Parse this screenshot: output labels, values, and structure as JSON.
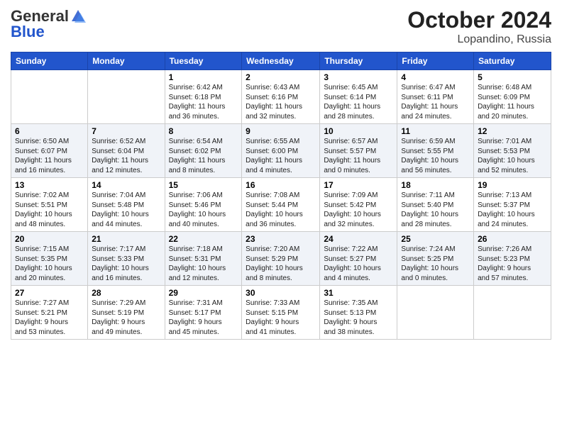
{
  "header": {
    "logo_general": "General",
    "logo_blue": "Blue",
    "title": "October 2024",
    "location": "Lopandino, Russia"
  },
  "weekdays": [
    "Sunday",
    "Monday",
    "Tuesday",
    "Wednesday",
    "Thursday",
    "Friday",
    "Saturday"
  ],
  "weeks": [
    [
      {
        "day": "",
        "info": ""
      },
      {
        "day": "",
        "info": ""
      },
      {
        "day": "1",
        "info": "Sunrise: 6:42 AM\nSunset: 6:18 PM\nDaylight: 11 hours\nand 36 minutes."
      },
      {
        "day": "2",
        "info": "Sunrise: 6:43 AM\nSunset: 6:16 PM\nDaylight: 11 hours\nand 32 minutes."
      },
      {
        "day": "3",
        "info": "Sunrise: 6:45 AM\nSunset: 6:14 PM\nDaylight: 11 hours\nand 28 minutes."
      },
      {
        "day": "4",
        "info": "Sunrise: 6:47 AM\nSunset: 6:11 PM\nDaylight: 11 hours\nand 24 minutes."
      },
      {
        "day": "5",
        "info": "Sunrise: 6:48 AM\nSunset: 6:09 PM\nDaylight: 11 hours\nand 20 minutes."
      }
    ],
    [
      {
        "day": "6",
        "info": "Sunrise: 6:50 AM\nSunset: 6:07 PM\nDaylight: 11 hours\nand 16 minutes."
      },
      {
        "day": "7",
        "info": "Sunrise: 6:52 AM\nSunset: 6:04 PM\nDaylight: 11 hours\nand 12 minutes."
      },
      {
        "day": "8",
        "info": "Sunrise: 6:54 AM\nSunset: 6:02 PM\nDaylight: 11 hours\nand 8 minutes."
      },
      {
        "day": "9",
        "info": "Sunrise: 6:55 AM\nSunset: 6:00 PM\nDaylight: 11 hours\nand 4 minutes."
      },
      {
        "day": "10",
        "info": "Sunrise: 6:57 AM\nSunset: 5:57 PM\nDaylight: 11 hours\nand 0 minutes."
      },
      {
        "day": "11",
        "info": "Sunrise: 6:59 AM\nSunset: 5:55 PM\nDaylight: 10 hours\nand 56 minutes."
      },
      {
        "day": "12",
        "info": "Sunrise: 7:01 AM\nSunset: 5:53 PM\nDaylight: 10 hours\nand 52 minutes."
      }
    ],
    [
      {
        "day": "13",
        "info": "Sunrise: 7:02 AM\nSunset: 5:51 PM\nDaylight: 10 hours\nand 48 minutes."
      },
      {
        "day": "14",
        "info": "Sunrise: 7:04 AM\nSunset: 5:48 PM\nDaylight: 10 hours\nand 44 minutes."
      },
      {
        "day": "15",
        "info": "Sunrise: 7:06 AM\nSunset: 5:46 PM\nDaylight: 10 hours\nand 40 minutes."
      },
      {
        "day": "16",
        "info": "Sunrise: 7:08 AM\nSunset: 5:44 PM\nDaylight: 10 hours\nand 36 minutes."
      },
      {
        "day": "17",
        "info": "Sunrise: 7:09 AM\nSunset: 5:42 PM\nDaylight: 10 hours\nand 32 minutes."
      },
      {
        "day": "18",
        "info": "Sunrise: 7:11 AM\nSunset: 5:40 PM\nDaylight: 10 hours\nand 28 minutes."
      },
      {
        "day": "19",
        "info": "Sunrise: 7:13 AM\nSunset: 5:37 PM\nDaylight: 10 hours\nand 24 minutes."
      }
    ],
    [
      {
        "day": "20",
        "info": "Sunrise: 7:15 AM\nSunset: 5:35 PM\nDaylight: 10 hours\nand 20 minutes."
      },
      {
        "day": "21",
        "info": "Sunrise: 7:17 AM\nSunset: 5:33 PM\nDaylight: 10 hours\nand 16 minutes."
      },
      {
        "day": "22",
        "info": "Sunrise: 7:18 AM\nSunset: 5:31 PM\nDaylight: 10 hours\nand 12 minutes."
      },
      {
        "day": "23",
        "info": "Sunrise: 7:20 AM\nSunset: 5:29 PM\nDaylight: 10 hours\nand 8 minutes."
      },
      {
        "day": "24",
        "info": "Sunrise: 7:22 AM\nSunset: 5:27 PM\nDaylight: 10 hours\nand 4 minutes."
      },
      {
        "day": "25",
        "info": "Sunrise: 7:24 AM\nSunset: 5:25 PM\nDaylight: 10 hours\nand 0 minutes."
      },
      {
        "day": "26",
        "info": "Sunrise: 7:26 AM\nSunset: 5:23 PM\nDaylight: 9 hours\nand 57 minutes."
      }
    ],
    [
      {
        "day": "27",
        "info": "Sunrise: 7:27 AM\nSunset: 5:21 PM\nDaylight: 9 hours\nand 53 minutes."
      },
      {
        "day": "28",
        "info": "Sunrise: 7:29 AM\nSunset: 5:19 PM\nDaylight: 9 hours\nand 49 minutes."
      },
      {
        "day": "29",
        "info": "Sunrise: 7:31 AM\nSunset: 5:17 PM\nDaylight: 9 hours\nand 45 minutes."
      },
      {
        "day": "30",
        "info": "Sunrise: 7:33 AM\nSunset: 5:15 PM\nDaylight: 9 hours\nand 41 minutes."
      },
      {
        "day": "31",
        "info": "Sunrise: 7:35 AM\nSunset: 5:13 PM\nDaylight: 9 hours\nand 38 minutes."
      },
      {
        "day": "",
        "info": ""
      },
      {
        "day": "",
        "info": ""
      }
    ]
  ]
}
